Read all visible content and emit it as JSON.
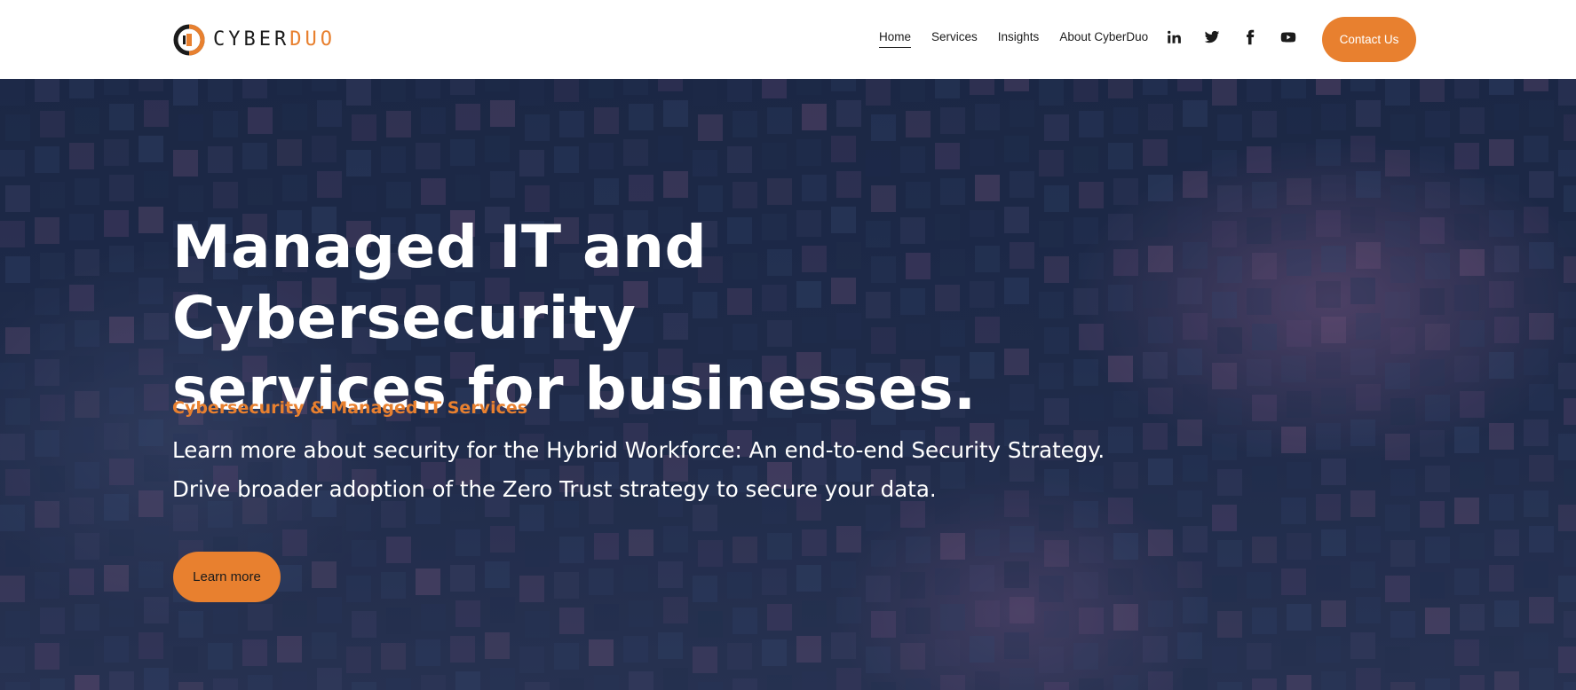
{
  "brand": {
    "logo_dark": "CYBER",
    "logo_accent": "DUO",
    "logo_icon": "cyberduo-logo-mark",
    "accent_color": "#e8802f"
  },
  "nav": {
    "items": [
      {
        "label": "Home",
        "active": true
      },
      {
        "label": "Services",
        "active": false
      },
      {
        "label": "Insights",
        "active": false
      },
      {
        "label": "About CyberDuo",
        "active": false
      }
    ]
  },
  "social": {
    "icons": [
      "linkedin-icon",
      "twitter-icon",
      "facebook-icon",
      "youtube-icon"
    ]
  },
  "header": {
    "contact_label": "Contact Us"
  },
  "hero": {
    "title_line1": "Managed IT and Cybersecurity",
    "title_line2": "services for businesses.",
    "subtitle": "Cybersecurity & Managed IT Services",
    "line1": "Learn more about security for the Hybrid Workforce:  An end-to-end Security Strategy.",
    "line2": "Drive broader adoption of the Zero Trust strategy to secure your data.",
    "cta_label": "Learn more",
    "background": "office-building-at-night"
  }
}
